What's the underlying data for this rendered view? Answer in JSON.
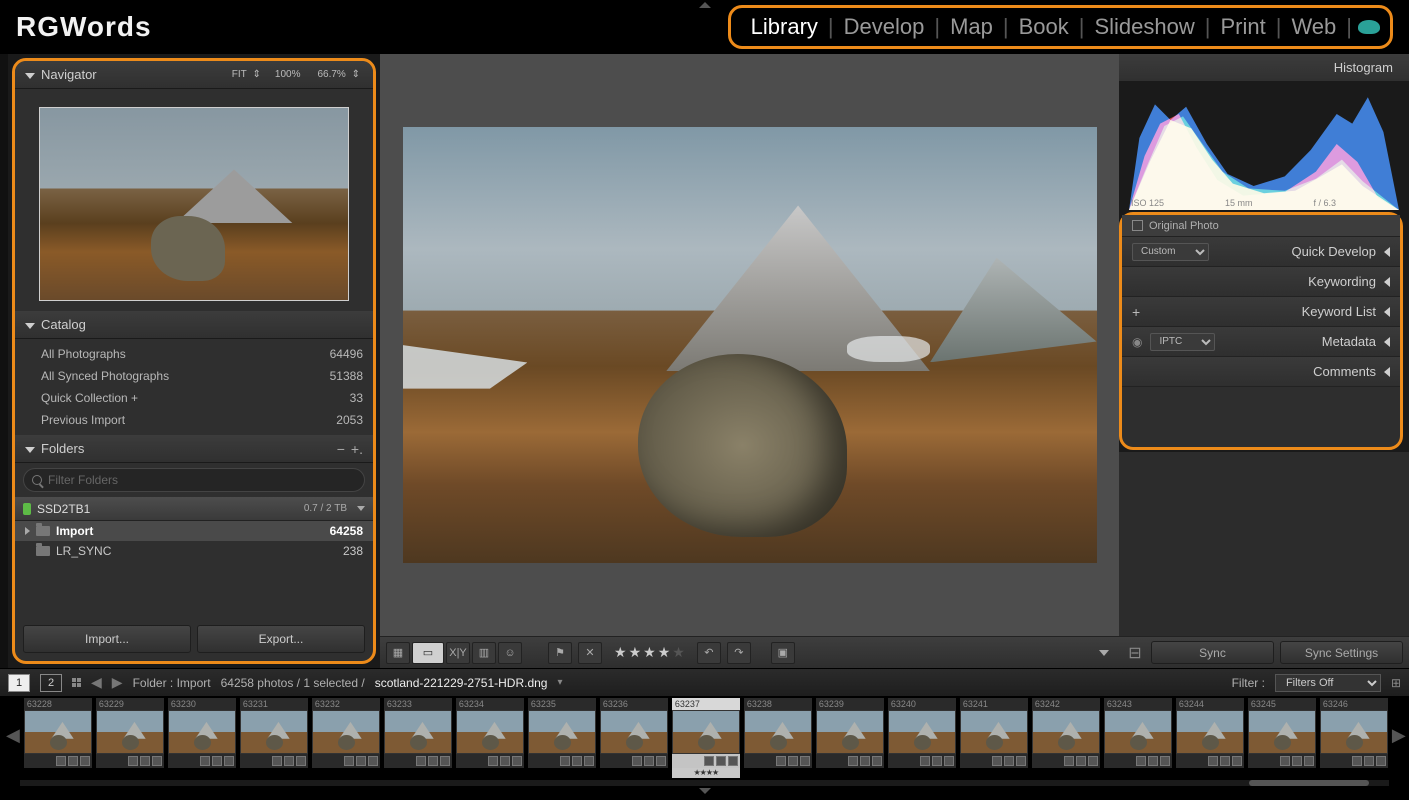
{
  "brand": "RGWords",
  "modules": [
    "Library",
    "Develop",
    "Map",
    "Book",
    "Slideshow",
    "Print",
    "Web"
  ],
  "active_module": "Library",
  "navigator": {
    "title": "Navigator",
    "zoom": {
      "fit": "FIT",
      "z100": "100%",
      "z66": "66.7%"
    }
  },
  "catalog": {
    "title": "Catalog",
    "items": [
      {
        "label": "All Photographs",
        "count": "64496"
      },
      {
        "label": "All Synced Photographs",
        "count": "51388"
      },
      {
        "label": "Quick Collection  +",
        "count": "33"
      },
      {
        "label": "Previous Import",
        "count": "2053"
      }
    ]
  },
  "folders": {
    "title": "Folders",
    "filter_placeholder": "Filter Folders",
    "volume": {
      "name": "SSD2TB1",
      "space": "0.7 / 2 TB"
    },
    "items": [
      {
        "name": "Import",
        "count": "64258",
        "selected": true
      },
      {
        "name": "LR_SYNC",
        "count": "238",
        "selected": false
      }
    ]
  },
  "buttons": {
    "import": "Import...",
    "export": "Export..."
  },
  "histogram": {
    "title": "Histogram",
    "meta": {
      "iso": "ISO 125",
      "mm": "15 mm",
      "f": "f / 6.3",
      "s": ""
    }
  },
  "right": {
    "original_photo": "Original Photo",
    "qd_select": "Custom",
    "quick_develop": "Quick Develop",
    "keywording": "Keywording",
    "keyword_list": "Keyword List",
    "meta_select": "IPTC",
    "metadata": "Metadata",
    "comments": "Comments"
  },
  "sync": {
    "sync": "Sync",
    "settings": "Sync Settings"
  },
  "toolbar": {
    "rating": 4
  },
  "secondary": {
    "crumb_prefix": "Folder : Import",
    "crumb_stats": "64258 photos / 1 selected /",
    "crumb_file": "scotland-221229-2751-HDR.dng",
    "filter_label": "Filter :",
    "filter_value": "Filters Off"
  },
  "filmstrip": {
    "selected_index": 9,
    "ids": [
      "63228",
      "63229",
      "63230",
      "63231",
      "63232",
      "63233",
      "63234",
      "63235",
      "63236",
      "63237",
      "63238",
      "63239",
      "63240",
      "63241",
      "63242",
      "63243",
      "63244",
      "63245",
      "63246"
    ]
  }
}
